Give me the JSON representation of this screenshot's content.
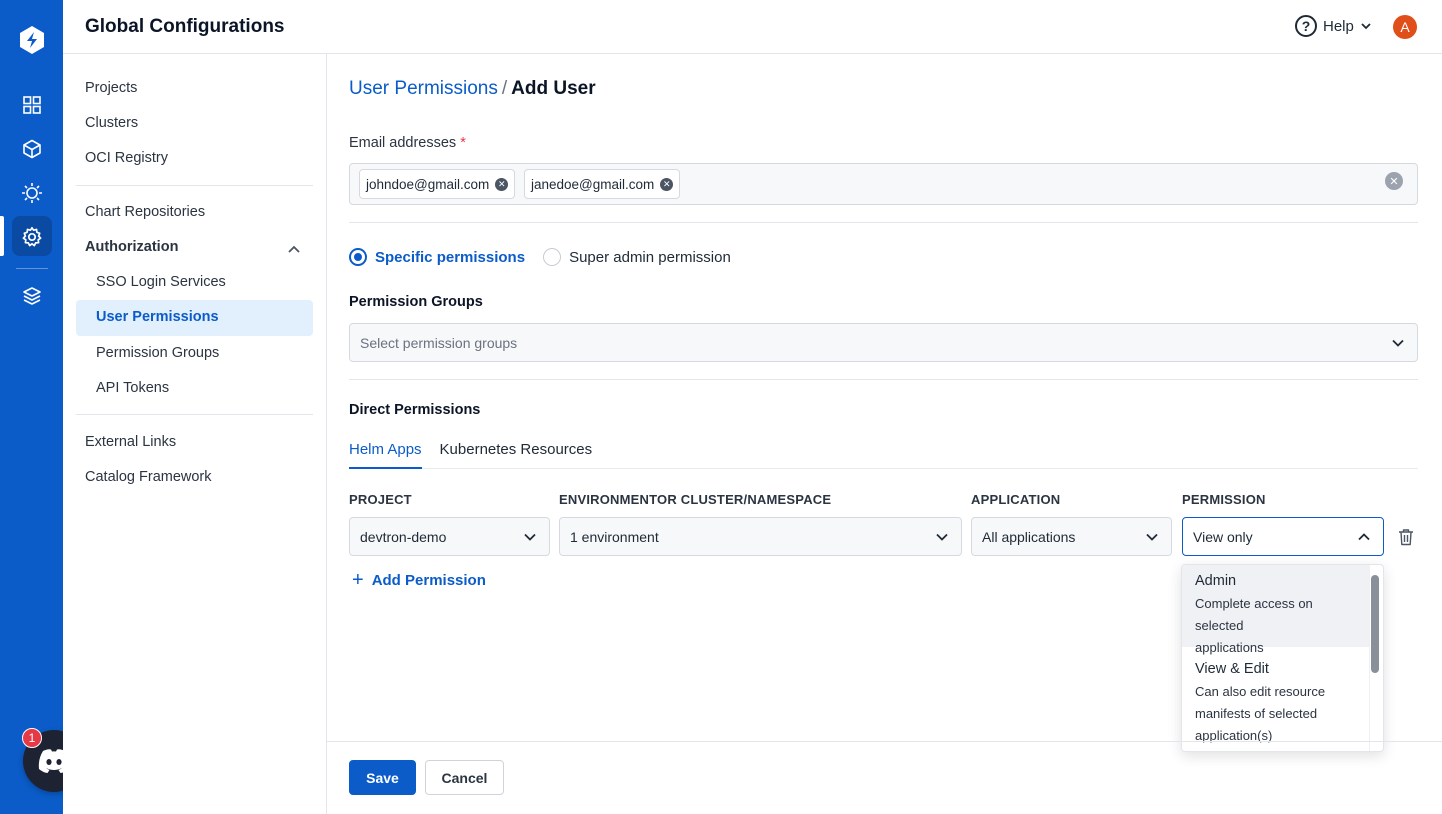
{
  "header": {
    "title": "Global Configurations",
    "help_label": "Help",
    "avatar_initial": "A"
  },
  "rail": {
    "icons": [
      "devtron-logo-icon",
      "grid-icon",
      "cube-icon",
      "bug-icon",
      "gear-icon",
      "layers-icon"
    ],
    "discord_badge": "1"
  },
  "subnav": {
    "projects": "Projects",
    "clusters": "Clusters",
    "oci_registry": "OCI Registry",
    "chart_repositories": "Chart Repositories",
    "authorization": "Authorization",
    "sso_login_services": "SSO Login Services",
    "user_permissions": "User Permissions",
    "permission_groups": "Permission Groups",
    "api_tokens": "API Tokens",
    "external_links": "External Links",
    "catalog_framework": "Catalog Framework"
  },
  "breadcrumb": {
    "parent": "User Permissions",
    "separator": "/",
    "current": "Add User"
  },
  "email": {
    "label": "Email addresses",
    "required_mark": "*",
    "chips": [
      "johndoe@gmail.com",
      "janedoe@gmail.com"
    ]
  },
  "permission_type": {
    "specific": "Specific permissions",
    "super_admin": "Super admin permission",
    "selected": "specific"
  },
  "permission_groups": {
    "label": "Permission Groups",
    "placeholder": "Select permission groups"
  },
  "direct_permissions": {
    "label": "Direct Permissions",
    "tabs": [
      "Helm Apps",
      "Kubernetes Resources"
    ],
    "active_tab": "Helm Apps",
    "columns": [
      "PROJECT",
      "ENVIRONMENTOR CLUSTER/NAMESPACE",
      "APPLICATION",
      "PERMISSION"
    ],
    "row": {
      "project": "devtron-demo",
      "environment": "1 environment",
      "application": "All applications",
      "permission": "View only"
    },
    "add_label": "Add Permission"
  },
  "permission_menu": [
    {
      "title": "Admin",
      "desc_lines": [
        "Complete access on selected",
        "applications"
      ]
    },
    {
      "title": "View & Edit",
      "desc_lines": [
        "Can also edit resource",
        "manifests of selected",
        "application(s)"
      ]
    }
  ],
  "footer": {
    "save": "Save",
    "cancel": "Cancel"
  },
  "colors": {
    "brand": "#0b5cc9",
    "rail": "#0b5cc9",
    "danger": "#e63946",
    "selected_bg": "#e2f0fd"
  }
}
